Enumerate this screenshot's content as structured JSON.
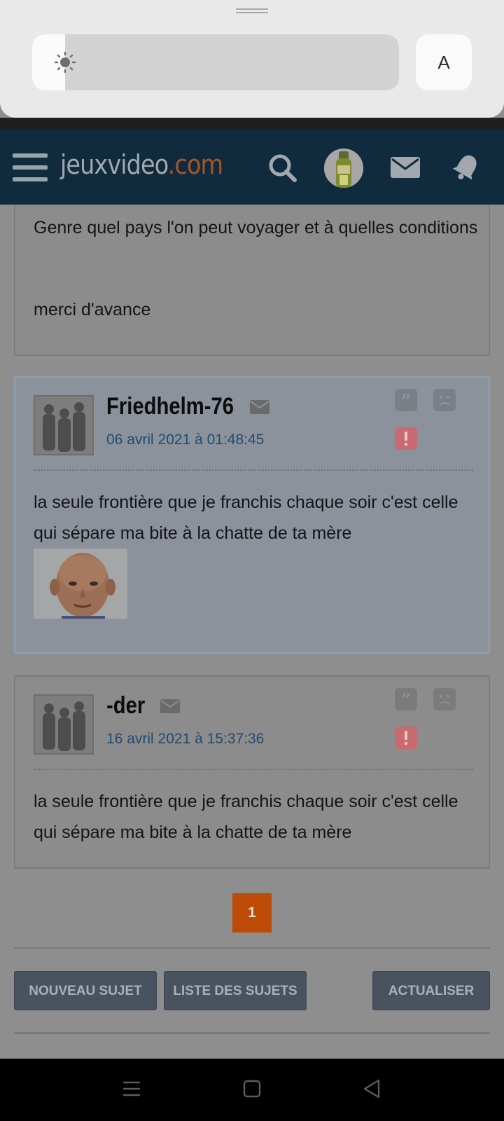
{
  "quick_settings": {
    "brightness_level": 0.09,
    "font_button_label": "A",
    "icons": {
      "brightness": "sun-icon"
    }
  },
  "header": {
    "logo_main": "jeuxvideo",
    "logo_tld": ".com",
    "icons": [
      "hamburger-menu-icon",
      "search-icon",
      "user-avatar",
      "mail-icon",
      "bell-icon"
    ]
  },
  "posts": [
    {
      "partial": true,
      "paragraphs": [
        "Genre quel pays l'on peut voyager et à quelles conditions",
        "merci d'avance"
      ]
    },
    {
      "author": "Friedhelm-76",
      "date": "06 avril 2021 à 01:48:45",
      "body": "la seule frontière que je franchis chaque soir c'est celle qui sépare ma bite à la chatte de ta mère",
      "has_image": true,
      "highlighted": true
    },
    {
      "author": "-der",
      "date": "16 avril 2021 à 15:37:36",
      "body": "la seule frontière que je franchis chaque soir c'est celle qui sépare ma bite à la chatte de ta mère",
      "has_image": false,
      "highlighted": false
    }
  ],
  "pagination": {
    "current_page": "1"
  },
  "actions": {
    "new_topic": "NOUVEAU SUJET",
    "topic_list": "LISTE DES SUJETS",
    "refresh": "ACTUALISER"
  },
  "post_action_icons": [
    "quote-icon",
    "sad-face-icon",
    "report-icon"
  ],
  "nav_bar": {
    "icons": [
      "recent-apps-icon",
      "home-icon",
      "back-icon"
    ]
  },
  "colors": {
    "header_bg": "#0f2b3d",
    "logo_accent": "#a8542a",
    "date_link": "#234b6f",
    "page_active": "#bd4a06",
    "action_button": "#495360",
    "report_icon": "#c86a6f"
  }
}
